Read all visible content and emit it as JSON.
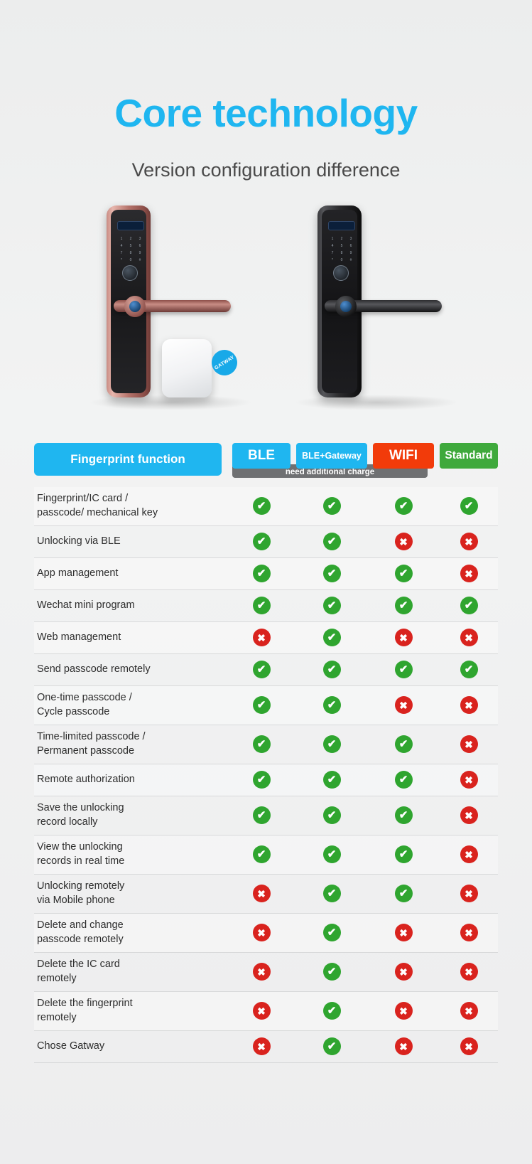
{
  "header": {
    "title": "Core technology",
    "subtitle": "Version configuration difference",
    "title_color": "#1FB6F0"
  },
  "product": {
    "lock_rose_label": "rose-gold-smart-lock",
    "lock_black_label": "black-smart-lock",
    "gateway_badge": "GATWAY",
    "keypad_keys": [
      "1",
      "2",
      "3",
      "4",
      "5",
      "6",
      "7",
      "8",
      "9",
      "*",
      "0",
      "#"
    ]
  },
  "table": {
    "feature_header": "Fingerprint function",
    "columns": [
      {
        "label": "BLE",
        "color": "#1FB6F0"
      },
      {
        "label": "BLE+Gateway",
        "color": "#1FB6F0"
      },
      {
        "label": "WIFI",
        "color": "#F23B0A"
      },
      {
        "label": "Standard",
        "color": "#3FA93C"
      }
    ],
    "note": "need additional charge",
    "yes_glyph": "✔",
    "no_glyph": "✖",
    "rows": [
      {
        "label": "Fingerprint/IC card /\npasscode/ mechanical key",
        "values": [
          "yes",
          "yes",
          "yes",
          "yes"
        ]
      },
      {
        "label": "Unlocking via BLE",
        "values": [
          "yes",
          "yes",
          "no",
          "no"
        ]
      },
      {
        "label": "App management",
        "values": [
          "yes",
          "yes",
          "yes",
          "no"
        ]
      },
      {
        "label": "Wechat mini program",
        "values": [
          "yes",
          "yes",
          "yes",
          "yes"
        ]
      },
      {
        "label": "Web management",
        "values": [
          "no",
          "yes",
          "no",
          "no"
        ]
      },
      {
        "label": "Send passcode remotely",
        "values": [
          "yes",
          "yes",
          "yes",
          "yes"
        ]
      },
      {
        "label": "One-time passcode /\nCycle passcode",
        "values": [
          "yes",
          "yes",
          "no",
          "no"
        ]
      },
      {
        "label": "Time-limited passcode /\nPermanent passcode",
        "values": [
          "yes",
          "yes",
          "yes",
          "no"
        ]
      },
      {
        "label": "Remote authorization",
        "values": [
          "yes",
          "yes",
          "yes",
          "no"
        ]
      },
      {
        "label": "Save the unlocking\nrecord locally",
        "values": [
          "yes",
          "yes",
          "yes",
          "no"
        ]
      },
      {
        "label": "View the unlocking\nrecords in real time",
        "values": [
          "yes",
          "yes",
          "yes",
          "no"
        ]
      },
      {
        "label": "Unlocking remotely\nvia Mobile phone",
        "values": [
          "no",
          "yes",
          "yes",
          "no"
        ]
      },
      {
        "label": "Delete and change\npasscode remotely",
        "values": [
          "no",
          "yes",
          "no",
          "no"
        ]
      },
      {
        "label": "Delete the IC card\nremotely",
        "values": [
          "no",
          "yes",
          "no",
          "no"
        ]
      },
      {
        "label": "Delete the fingerprint\nremotely",
        "values": [
          "no",
          "yes",
          "no",
          "no"
        ]
      },
      {
        "label": "Chose Gatway",
        "values": [
          "no",
          "yes",
          "no",
          "no"
        ]
      }
    ]
  }
}
